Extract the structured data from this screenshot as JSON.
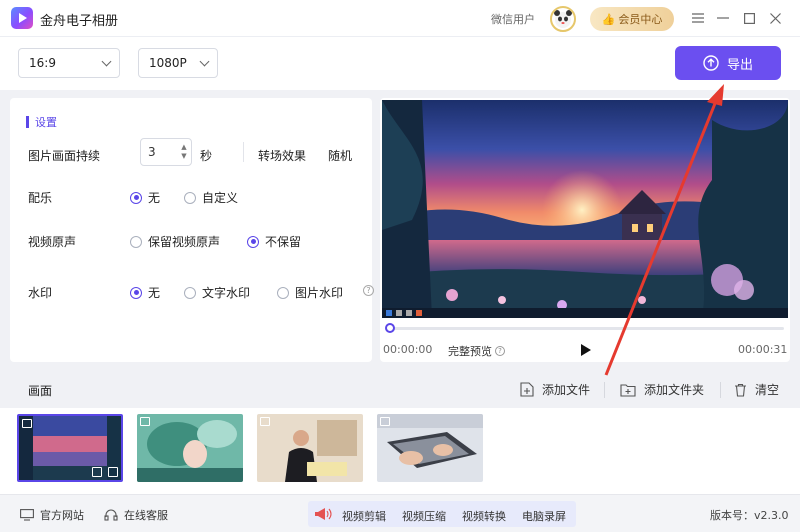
{
  "app": {
    "title": "金舟电子相册"
  },
  "header": {
    "user_name": "微信用户",
    "vip_label": "会员中心",
    "menu_icon": "menu-icon",
    "minimize_icon": "minimize-icon",
    "maximize_icon": "maximize-icon",
    "close_icon": "close-icon"
  },
  "toolbar": {
    "aspect_ratio": "16:9",
    "resolution": "1080P",
    "export_label": "导出"
  },
  "settings": {
    "title": "设置",
    "duration_label": "图片画面持续",
    "duration_value": "3",
    "duration_unit": "秒",
    "transition_label": "转场效果",
    "transition_value": "随机",
    "music_label": "配乐",
    "music_options": [
      "无",
      "自定义"
    ],
    "music_selected": 0,
    "audio_label": "视频原声",
    "audio_options": [
      "保留视频原声",
      "不保留"
    ],
    "audio_selected": 1,
    "watermark_label": "水印",
    "watermark_options": [
      "无",
      "文字水印",
      "图片水印"
    ],
    "watermark_selected": 0
  },
  "preview": {
    "current_time": "00:00:00",
    "full_preview_label": "完整预览",
    "total_time": "00:00:31",
    "progress": 0
  },
  "frames": {
    "title": "画面",
    "add_file_label": "添加文件",
    "add_folder_label": "添加文件夹",
    "clear_label": "清空"
  },
  "statusbar": {
    "website_label": "官方网站",
    "support_label": "在线客服",
    "promo_items": [
      "视频剪辑",
      "视频压缩",
      "视频转换",
      "电脑录屏"
    ],
    "version": "版本号：v2.3.0"
  },
  "colors": {
    "accent": "#6b4ff0",
    "vip_text": "#8a5a19",
    "annotation_arrow": "#e53a2f"
  }
}
